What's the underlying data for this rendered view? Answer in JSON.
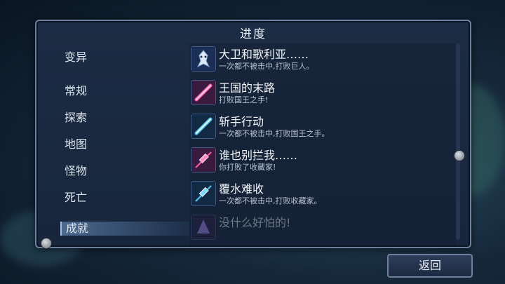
{
  "panel": {
    "title": "进度"
  },
  "nav": {
    "items": [
      {
        "label": "变异"
      },
      {
        "label": "常规"
      },
      {
        "label": "探索"
      },
      {
        "label": "地图"
      },
      {
        "label": "怪物"
      },
      {
        "label": "死亡"
      },
      {
        "label": "成就"
      }
    ],
    "active": "成就"
  },
  "achievements": [
    {
      "title": "大卫和歌利亚……",
      "desc": "一次都不被击中,打败巨人。",
      "icon": "giant-icon"
    },
    {
      "title": "王国的末路",
      "desc": "打败国王之手!",
      "icon": "pink-sword-icon"
    },
    {
      "title": "斩手行动",
      "desc": "一次都不被击中,打败国王之手。",
      "icon": "blue-sword-icon"
    },
    {
      "title": "谁也别拦我……",
      "desc": "你打败了收藏家!",
      "icon": "pink-syringe-icon"
    },
    {
      "title": "覆水难收",
      "desc": "一次都不被击中,打败收藏家。",
      "icon": "blue-syringe-icon"
    },
    {
      "title": "没什么好怕的!",
      "desc": "",
      "icon": "purple-icon"
    }
  ],
  "footer": {
    "back_label": "返回"
  },
  "colors": {
    "panel_bg": "#1c2c44",
    "border": "#6c7f9c",
    "highlight": "#9cc0e6"
  }
}
